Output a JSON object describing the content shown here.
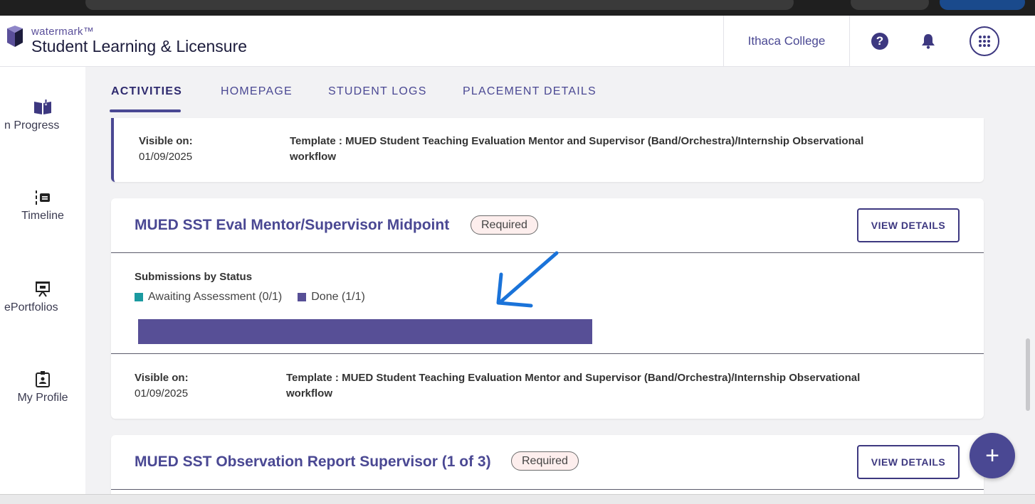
{
  "header": {
    "brand_small": "watermark™",
    "brand_title": "Student Learning & Licensure",
    "institution": "Ithaca College",
    "help_glyph": "?"
  },
  "sidebar": {
    "items": [
      {
        "label": "n Progress",
        "icon": "book-open-icon"
      },
      {
        "label": "Timeline",
        "icon": "timeline-icon"
      },
      {
        "label": "ePortfolios",
        "icon": "presentation-icon"
      },
      {
        "label": "My Profile",
        "icon": "profile-badge-icon"
      }
    ]
  },
  "tabs": [
    {
      "label": "ACTIVITIES",
      "active": true
    },
    {
      "label": "HOMEPAGE",
      "active": false
    },
    {
      "label": "STUDENT LOGS",
      "active": false
    },
    {
      "label": "PLACEMENT DETAILS",
      "active": false
    }
  ],
  "cards": [
    {
      "visible_on_label": "Visible on:",
      "visible_on_date": "01/09/2025",
      "template_line1": "Template : MUED Student Teaching Evaluation Mentor and Supervisor (Band/Orchestra)/Internship Observational",
      "template_line2": "workflow"
    },
    {
      "title": "MUED SST Eval Mentor/Supervisor Midpoint",
      "badge": "Required",
      "button": "VIEW DETAILS",
      "submissions_label": "Submissions by Status",
      "legend": [
        {
          "label": "Awaiting Assessment (0/1)",
          "color": "#1b9aa0"
        },
        {
          "label": "Done (1/1)",
          "color": "#574f96"
        }
      ],
      "done_fraction": 1.0,
      "visible_on_label": "Visible on:",
      "visible_on_date": "01/09/2025",
      "template_line1": "Template : MUED Student Teaching Evaluation Mentor and Supervisor (Band/Orchestra)/Internship Observational",
      "template_line2": "workflow"
    },
    {
      "title": "MUED SST Observation Report Supervisor (1 of 3)",
      "badge": "Required",
      "button": "VIEW DETAILS"
    }
  ],
  "fab": {
    "label": "+"
  },
  "colors": {
    "accent": "#4a4893",
    "bar": "#574f96",
    "annotation_arrow": "#1a73d9",
    "badge_bg": "#fdeeed"
  }
}
